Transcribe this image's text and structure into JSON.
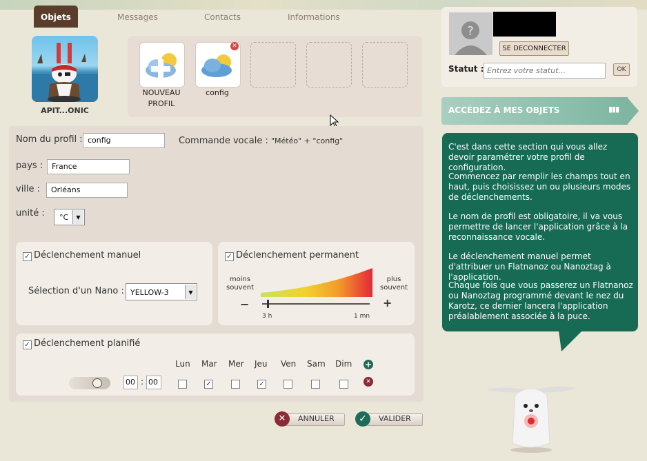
{
  "tabs": [
    {
      "label": "Objets",
      "active": true
    },
    {
      "label": "Messages",
      "active": false
    },
    {
      "label": "Contacts",
      "active": false
    },
    {
      "label": "Informations",
      "active": false
    }
  ],
  "avatar_name": "APIT...ONIC",
  "slots": [
    {
      "label": "NOUVEAU PROFIL",
      "label_line1": "NOUVEAU",
      "label_line2": "PROFIL"
    },
    {
      "label": "config"
    }
  ],
  "form": {
    "nom_label": "Nom du profil :",
    "nom_value": "config",
    "commande_label": "Commande vocale :",
    "commande_value": "\"Météo\" + \"config\"",
    "pays_label": "pays :",
    "pays_value": "France",
    "ville_label": "ville :",
    "ville_value": "Orléans",
    "unite_label": "unité :",
    "unite_value": "°C"
  },
  "manuel": {
    "title": "Déclenchement manuel",
    "checked": true,
    "nano_label": "Sélection d'un Nano :",
    "nano_value": "YELLOW-3"
  },
  "permanent": {
    "title": "Déclenchement permanent",
    "checked": true,
    "less_line1": "moins",
    "less_line2": "souvent",
    "more_line1": "plus",
    "more_line2": "souvent",
    "min_label": "3 h",
    "max_label": "1 mn",
    "minus": "−",
    "plus": "+",
    "level": 0.05
  },
  "planifie": {
    "title": "Déclenchement planifié",
    "checked": true,
    "days": [
      {
        "label": "Lun",
        "checked": false
      },
      {
        "label": "Mar",
        "checked": true
      },
      {
        "label": "Mer",
        "checked": false
      },
      {
        "label": "Jeu",
        "checked": true
      },
      {
        "label": "Ven",
        "checked": false
      },
      {
        "label": "Sam",
        "checked": false
      },
      {
        "label": "Dim",
        "checked": false
      }
    ],
    "hour": "00",
    "minute": "00",
    "separator": ":"
  },
  "buttons": {
    "cancel": "ANNULER",
    "validate": "VALIDER"
  },
  "profile": {
    "logout": "SE DECONNECTER",
    "status_label": "Statut :",
    "status_placeholder": "Entrez votre statut...",
    "ok": "OK"
  },
  "banner": "ACCÉDEZ À MES OBJETS",
  "help": [
    "C'est dans cette section qui vous allez devoir paramétrer votre profil de configuration.",
    "Commencez par remplir les champs tout en haut, puis choisissez un ou plusieurs modes de déclenchements.",
    "Le nom de profil est obligatoire, il va vous permettre de lancer l'application grâce à la reconnaissance vocale.",
    "Le déclenchement manuel permet d'attribuer un Flatnanoz ou Nanoztag à l'application.",
    "Chaque fois que vous passerez un Flatnanoz ou Nanoztag programmé devant le nez du Karotz, ce dernier lancera l'application préalablement associée à la puce."
  ],
  "colors": {
    "tab_active": "#5a3e2b",
    "banner": "#7eb6a2",
    "bubble": "#176b54",
    "cancel": "#8b2a35",
    "validate": "#1d6c5a"
  }
}
